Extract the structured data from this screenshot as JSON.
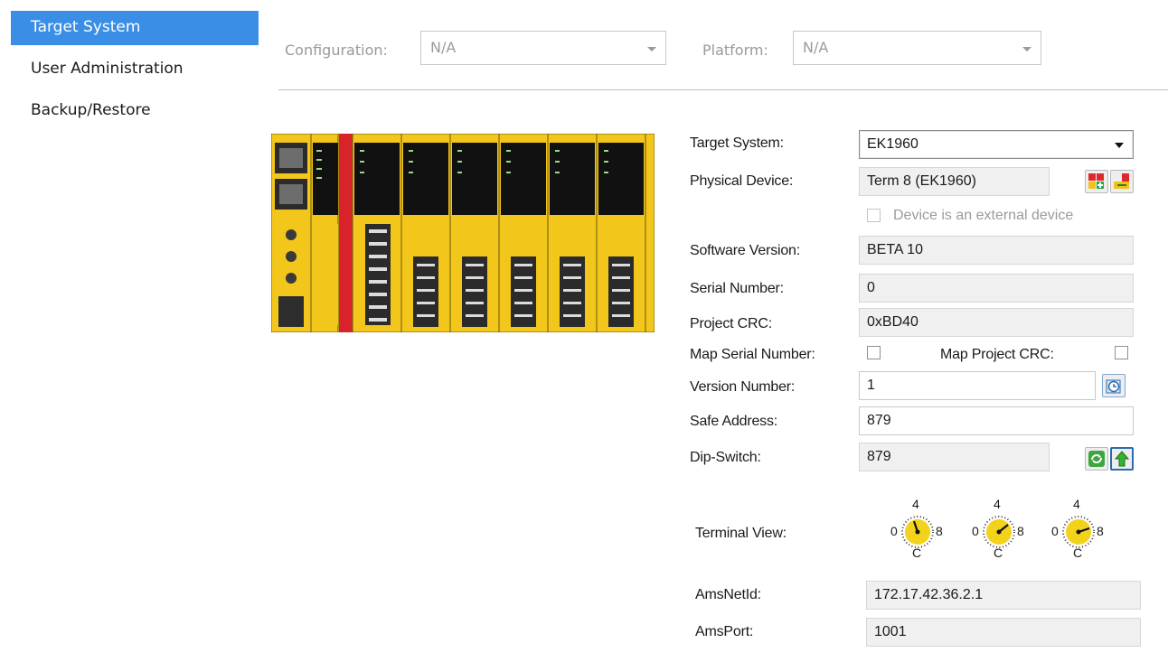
{
  "nav": {
    "items": [
      {
        "label": "Target System",
        "active": true
      },
      {
        "label": "User Administration",
        "active": false
      },
      {
        "label": "Backup/Restore",
        "active": false
      }
    ]
  },
  "top": {
    "configuration_label": "Configuration:",
    "configuration_value": "N/A",
    "platform_label": "Platform:",
    "platform_value": "N/A"
  },
  "form": {
    "target_system_label": "Target System:",
    "target_system_value": "EK1960",
    "physical_device_label": "Physical Device:",
    "physical_device_value": "Term 8 (EK1960)",
    "external_device_label": "Device is an external device",
    "software_version_label": "Software Version:",
    "software_version_value": "BETA 10",
    "serial_number_label": "Serial Number:",
    "serial_number_value": "0",
    "project_crc_label": "Project CRC:",
    "project_crc_value": "0xBD40",
    "map_serial_label": "Map Serial Number:",
    "map_crc_label": "Map Project CRC:",
    "version_number_label": "Version Number:",
    "version_number_value": "1",
    "safe_address_label": "Safe Address:",
    "safe_address_value": "879",
    "dip_switch_label": "Dip-Switch:",
    "dip_switch_value": "879",
    "terminal_view_label": "Terminal View:",
    "dial_labels": {
      "top": "4",
      "left": "0",
      "right": "8",
      "bottom": "C"
    },
    "amsnetid_label": "AmsNetId:",
    "amsnetid_value": "172.17.42.36.2.1",
    "amsport_label": "AmsPort:",
    "amsport_value": "1001"
  },
  "colors": {
    "accent": "#3a8ee6",
    "device_yellow": "#f3c61b",
    "device_red": "#d8232a"
  }
}
